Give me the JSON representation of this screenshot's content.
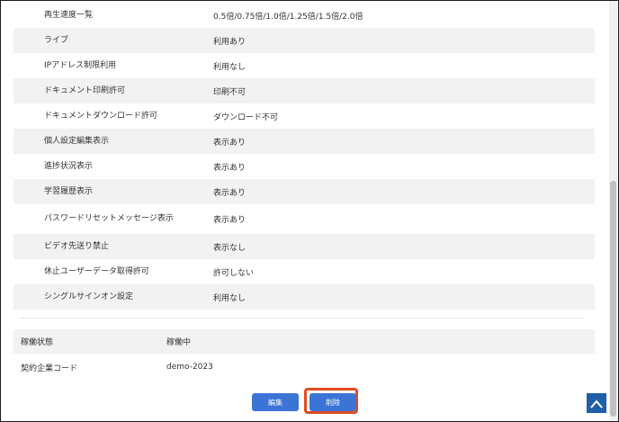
{
  "settings": [
    {
      "label": "再生速度一覧",
      "value": "0.5倍/0.75倍/1.0倍/1.25倍/1.5倍/2.0倍"
    },
    {
      "label": "ライブ",
      "value": "利用あり"
    },
    {
      "label": "IPアドレス制限利用",
      "value": "利用なし"
    },
    {
      "label": "ドキュメント印刷許可",
      "value": "印刷不可"
    },
    {
      "label": "ドキュメントダウンロード許可",
      "value": "ダウンロード不可"
    },
    {
      "label": "個人設定編集表示",
      "value": "表示あり"
    },
    {
      "label": "進捗状況表示",
      "value": "表示あり"
    },
    {
      "label": "学習履歴表示",
      "value": "表示あり"
    },
    {
      "label": "パスワードリセットメッセージ表示",
      "value": "表示あり"
    },
    {
      "label": "ビデオ先送り禁止",
      "value": "表示なし"
    },
    {
      "label": "休止ユーザーデータ取得許可",
      "value": "許可しない"
    },
    {
      "label": "シングルサインオン設定",
      "value": "利用なし"
    }
  ],
  "status": [
    {
      "label": "稼働状態",
      "value": "稼働中"
    },
    {
      "label": "契約企業コード",
      "value": "demo-2023"
    }
  ],
  "buttons": {
    "edit": "編集",
    "delete": "削除"
  },
  "icons": {
    "scroll_top": "chevron-up-icon"
  },
  "colors": {
    "button": "#3b74d4",
    "highlight": "#e04a1f",
    "scroll_top": "#1f5fa8"
  }
}
